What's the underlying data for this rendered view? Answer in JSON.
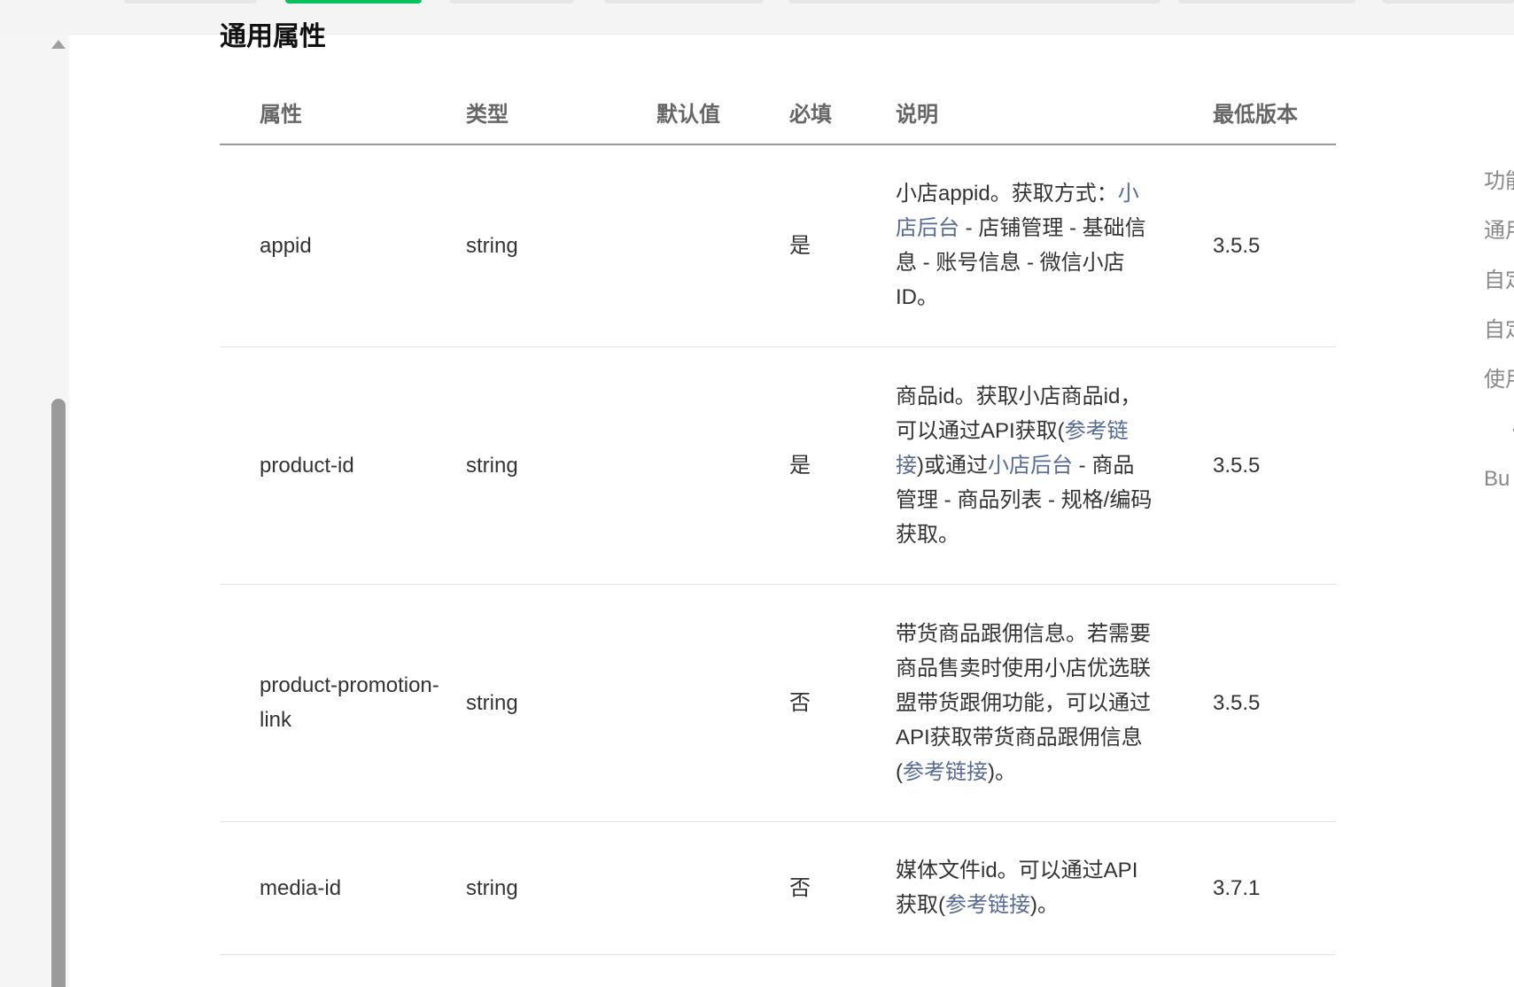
{
  "section": {
    "title": "通用属性"
  },
  "table": {
    "headers": [
      "属性",
      "类型",
      "默认值",
      "必填",
      "说明",
      "最低版本"
    ],
    "rows": [
      {
        "attr": "appid",
        "type": "string",
        "default": "",
        "required": "是",
        "desc": [
          {
            "t": "小店appid。获取方式：",
            "link": false
          },
          {
            "t": "小店后台",
            "link": true
          },
          {
            "t": " - 店铺管理 - 基础信息 - 账号信息 - 微信小店ID。",
            "link": false
          }
        ],
        "version": "3.5.5"
      },
      {
        "attr": "product-id",
        "type": "string",
        "default": "",
        "required": "是",
        "desc": [
          {
            "t": "商品id。获取小店商品id，可以通过API获取(",
            "link": false
          },
          {
            "t": "参考链接",
            "link": true
          },
          {
            "t": ")或通过",
            "link": false
          },
          {
            "t": "小店后台",
            "link": true
          },
          {
            "t": " - 商品管理 - 商品列表 - 规格/编码获取。",
            "link": false
          }
        ],
        "version": "3.5.5"
      },
      {
        "attr": "product-promotion-link",
        "type": "string",
        "default": "",
        "required": "否",
        "desc": [
          {
            "t": "带货商品跟佣信息。若需要商品售卖时使用小店优选联盟带货跟佣功能，可以通过API获取带货商品跟佣信息(",
            "link": false
          },
          {
            "t": "参考链接",
            "link": true
          },
          {
            "t": ")。",
            "link": false
          }
        ],
        "version": "3.5.5"
      },
      {
        "attr": "media-id",
        "type": "string",
        "default": "",
        "required": "否",
        "desc": [
          {
            "t": "媒体文件id。可以通过API获取(",
            "link": false
          },
          {
            "t": "参考链接",
            "link": true
          },
          {
            "t": ")。",
            "link": false
          }
        ],
        "version": "3.7.1"
      }
    ]
  },
  "outline": {
    "items": [
      {
        "label": "功能",
        "sub": false
      },
      {
        "label": "通用",
        "sub": false
      },
      {
        "label": "自定",
        "sub": false
      },
      {
        "label": "自定",
        "sub": false
      },
      {
        "label": "使用",
        "sub": false
      },
      {
        "label": "·",
        "sub": true
      },
      {
        "label": "Bu",
        "sub": false
      }
    ]
  },
  "colors": {
    "link": "#576b95",
    "active_tab": "#07c160",
    "header_text": "#666666"
  }
}
